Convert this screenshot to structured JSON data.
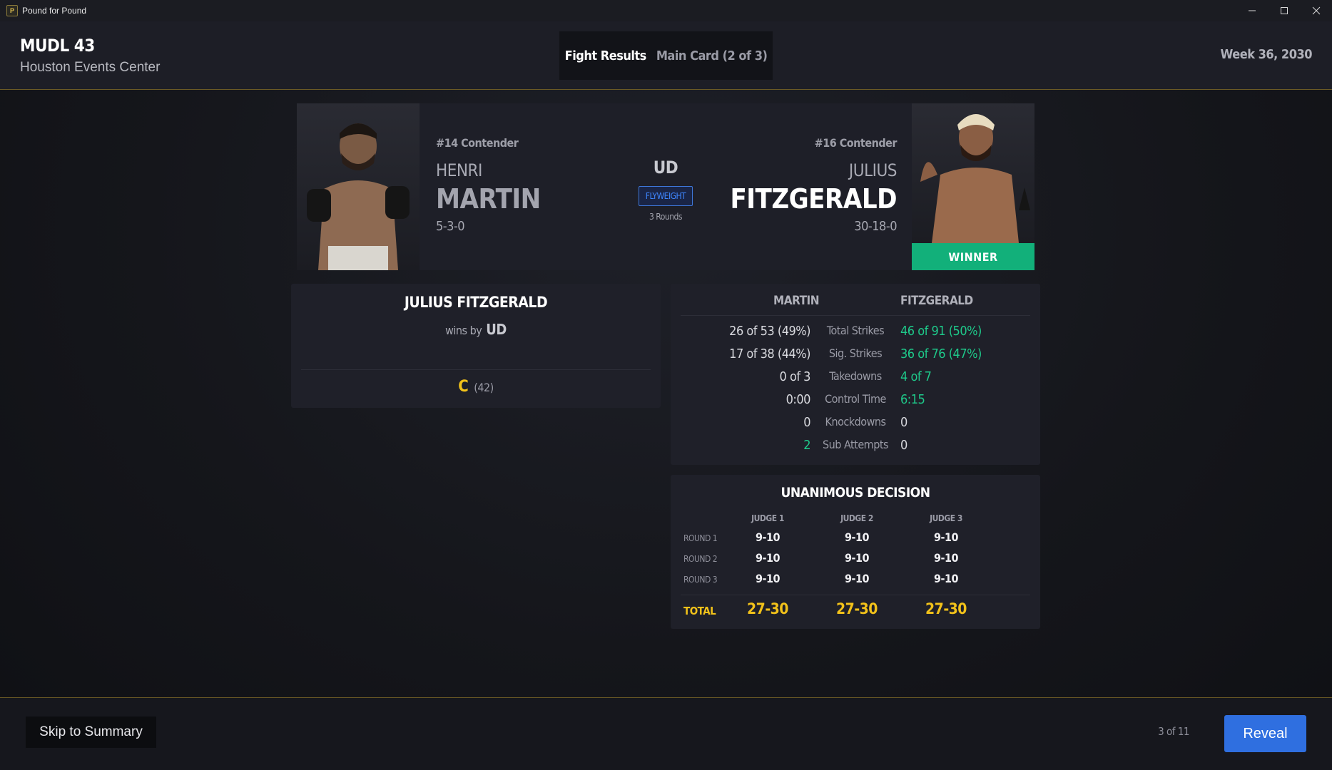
{
  "window": {
    "title": "Pound for Pound",
    "minimize_icon": "minimize-icon",
    "maximize_icon": "maximize-icon",
    "close_icon": "close-icon"
  },
  "header": {
    "event_name": "MUDL 43",
    "venue": "Houston Events Center",
    "section_title": "Fight Results",
    "card_label": "Main Card (2 of 3)",
    "week": "Week 36, 2030"
  },
  "fight": {
    "method": "UD",
    "weight_class": "FLYWEIGHT",
    "rounds": "3 Rounds",
    "left": {
      "rank": "#14 Contender",
      "first_name": "HENRI",
      "last_name": "MARTIN",
      "record": "5-3-0"
    },
    "right": {
      "rank": "#16 Contender",
      "first_name": "JULIUS",
      "last_name": "FITZGERALD",
      "record": "30-18-0",
      "winner_label": "WINNER"
    }
  },
  "result": {
    "winner": "JULIUS FITZGERALD",
    "wins_by": "wins by",
    "method": "UD",
    "grade": "C",
    "grade_score": "(42)"
  },
  "stats": {
    "left_header": "MARTIN",
    "right_header": "FITZGERALD",
    "rows": [
      {
        "label": "Total Strikes",
        "left": "26 of 53 (49%)",
        "right": "46 of 91 (50%)"
      },
      {
        "label": "Sig. Strikes",
        "left": "17 of 38 (44%)",
        "right": "36 of 76 (47%)"
      },
      {
        "label": "Takedowns",
        "left": "0 of 3",
        "right": "4 of 7"
      },
      {
        "label": "Control Time",
        "left": "0:00",
        "right": "6:15"
      },
      {
        "label": "Knockdowns",
        "left": "0",
        "right": "0"
      },
      {
        "label": "Sub Attempts",
        "left": "2",
        "right": "0"
      }
    ]
  },
  "decision": {
    "title": "UNANIMOUS DECISION",
    "judges": [
      "JUDGE 1",
      "JUDGE 2",
      "JUDGE 3"
    ],
    "rounds": [
      {
        "label": "ROUND 1",
        "scores": [
          "9-10",
          "9-10",
          "9-10"
        ]
      },
      {
        "label": "ROUND 2",
        "scores": [
          "9-10",
          "9-10",
          "9-10"
        ]
      },
      {
        "label": "ROUND 3",
        "scores": [
          "9-10",
          "9-10",
          "9-10"
        ]
      }
    ],
    "total_label": "TOTAL",
    "totals": [
      "27-30",
      "27-30",
      "27-30"
    ]
  },
  "footer": {
    "skip_label": "Skip to Summary",
    "progress": "3 of 11",
    "reveal_label": "Reveal"
  },
  "colors": {
    "accent_gold": "#f2c21a",
    "winner_green": "#12b07a",
    "stat_green": "#1ec98a",
    "primary_blue": "#2f6fe0"
  }
}
